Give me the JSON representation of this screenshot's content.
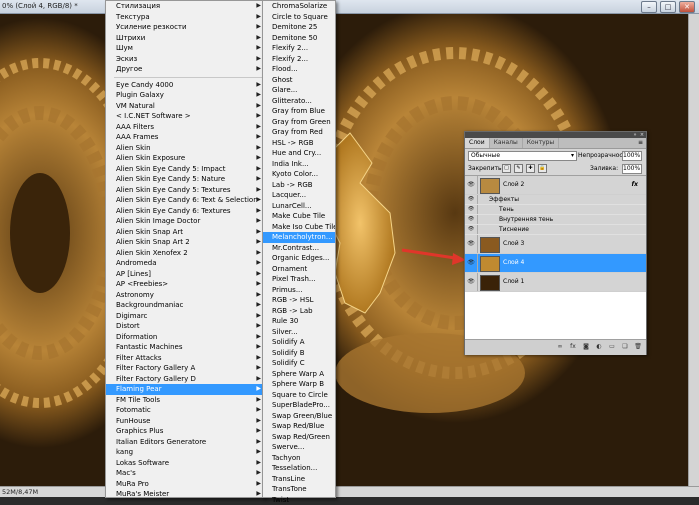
{
  "document": {
    "title": "0% (Слой 4, RGB/8) *",
    "status": "52M/8,47M",
    "window_buttons": [
      "–",
      "□",
      "✕"
    ]
  },
  "filter_menu": {
    "items": [
      {
        "label": "Стилизация",
        "submenu": true
      },
      {
        "label": "Текстура",
        "submenu": true
      },
      {
        "label": "Усиление резкости",
        "submenu": true
      },
      {
        "label": "Штрихи",
        "submenu": true
      },
      {
        "label": "Шум",
        "submenu": true
      },
      {
        "label": "Эскиз",
        "submenu": true
      },
      {
        "label": "Другое",
        "submenu": true
      },
      {
        "separator": true
      },
      {
        "label": "Eye Candy 4000",
        "submenu": true
      },
      {
        "label": "Plugin Galaxy",
        "submenu": true
      },
      {
        "label": "VM Natural",
        "submenu": true
      },
      {
        "label": "< I.C.NET Software >",
        "submenu": true
      },
      {
        "label": "AAA Filters",
        "submenu": true
      },
      {
        "label": "AAA Frames",
        "submenu": true
      },
      {
        "label": "Alien Skin",
        "submenu": true
      },
      {
        "label": "Alien Skin Exposure",
        "submenu": true
      },
      {
        "label": "Alien Skin Eye Candy 5: Impact",
        "submenu": true
      },
      {
        "label": "Alien Skin Eye Candy 5: Nature",
        "submenu": true
      },
      {
        "label": "Alien Skin Eye Candy 5: Textures",
        "submenu": true
      },
      {
        "label": "Alien Skin Eye Candy 6: Text & Selection",
        "submenu": true
      },
      {
        "label": "Alien Skin Eye Candy 6: Textures",
        "submenu": true
      },
      {
        "label": "Alien Skin Image Doctor",
        "submenu": true
      },
      {
        "label": "Alien Skin Snap Art",
        "submenu": true
      },
      {
        "label": "Alien Skin Snap Art 2",
        "submenu": true
      },
      {
        "label": "Alien Skin Xenofex 2",
        "submenu": true
      },
      {
        "label": "Andromeda",
        "submenu": true
      },
      {
        "label": "AP [Lines]",
        "submenu": true
      },
      {
        "label": "AP <Freebies>",
        "submenu": true
      },
      {
        "label": "Astronomy",
        "submenu": true
      },
      {
        "label": "Backgroundmaniac",
        "submenu": true
      },
      {
        "label": "Digimarc",
        "submenu": true
      },
      {
        "label": "Distort",
        "submenu": true
      },
      {
        "label": "Diformation",
        "submenu": true
      },
      {
        "label": "Fantastic Machines",
        "submenu": true
      },
      {
        "label": "Filter Attacks",
        "submenu": true
      },
      {
        "label": "Filter Factory Gallery A",
        "submenu": true
      },
      {
        "label": "Filter Factory Gallery D",
        "submenu": true
      },
      {
        "label": "Flaming Pear",
        "submenu": true,
        "selected": true
      },
      {
        "label": "FM Tile Tools",
        "submenu": true
      },
      {
        "label": "Fotomatic",
        "submenu": true
      },
      {
        "label": "FunHouse",
        "submenu": true
      },
      {
        "label": "Graphics Plus",
        "submenu": true
      },
      {
        "label": "Italian Editors Generatore",
        "submenu": true
      },
      {
        "label": "kang",
        "submenu": true
      },
      {
        "label": "Lokas Software",
        "submenu": true
      },
      {
        "label": "Mac's",
        "submenu": true
      },
      {
        "label": "MuRa Pro",
        "submenu": true
      },
      {
        "label": "MuRa's Meister",
        "submenu": true
      }
    ]
  },
  "flaming_pear_menu": {
    "items": [
      {
        "label": "ChromaSolarize"
      },
      {
        "label": "Circle to Square"
      },
      {
        "label": "Demitone 25"
      },
      {
        "label": "Demitone 50"
      },
      {
        "label": "Flexify 2..."
      },
      {
        "label": "Flexify 2..."
      },
      {
        "label": "Flood..."
      },
      {
        "label": "Ghost"
      },
      {
        "label": "Glare..."
      },
      {
        "label": "Glitterato..."
      },
      {
        "label": "Gray from Blue"
      },
      {
        "label": "Gray from Green"
      },
      {
        "label": "Gray from Red"
      },
      {
        "label": "HSL -> RGB"
      },
      {
        "label": "Hue and Cry..."
      },
      {
        "label": "India Ink..."
      },
      {
        "label": "Kyoto Color..."
      },
      {
        "label": "Lab -> RGB"
      },
      {
        "label": "Lacquer..."
      },
      {
        "label": "LunarCell..."
      },
      {
        "label": "Make Cube Tile"
      },
      {
        "label": "Make Iso Cube Tile"
      },
      {
        "label": "Melancholytron...",
        "selected": true
      },
      {
        "label": "Mr.Contrast..."
      },
      {
        "label": "Organic Edges..."
      },
      {
        "label": "Ornament"
      },
      {
        "label": "Pixel Trash..."
      },
      {
        "label": "Primus..."
      },
      {
        "label": "RGB -> HSL"
      },
      {
        "label": "RGB -> Lab"
      },
      {
        "label": "Rule 30"
      },
      {
        "label": "Silver..."
      },
      {
        "label": "Solidify A"
      },
      {
        "label": "Solidify B"
      },
      {
        "label": "Solidify C"
      },
      {
        "label": "Sphere Warp A"
      },
      {
        "label": "Sphere Warp B"
      },
      {
        "label": "Square to Circle"
      },
      {
        "label": "SuperBladePro..."
      },
      {
        "label": "Swap Green/Blue"
      },
      {
        "label": "Swap Red/Blue"
      },
      {
        "label": "Swap Red/Green"
      },
      {
        "label": "Swerve..."
      },
      {
        "label": "Tachyon"
      },
      {
        "label": "Tesselation..."
      },
      {
        "label": "TransLine"
      },
      {
        "label": "TransTone"
      },
      {
        "label": "Twist"
      }
    ]
  },
  "layers_panel": {
    "tabs": [
      "Слои",
      "Каналы",
      "Контуры"
    ],
    "active_tab": 0,
    "blend_mode": "Обычные",
    "opacity_label": "Непрозрачность:",
    "opacity_value": "100%",
    "lock_label": "Закрепить:",
    "fill_label": "Заливка:",
    "fill_value": "100%",
    "lock_icons": [
      "□",
      "✎",
      "✚",
      "🔒"
    ],
    "fx_badge": "fx",
    "effects_label": "Эффекты",
    "effects": [
      "Тень",
      "Внутренняя тень",
      "Тиснение"
    ],
    "layers": [
      {
        "name": "Слой 2",
        "thumb": "#b88a40"
      },
      {
        "name": "Слой 3",
        "thumb": "#8a5a20"
      },
      {
        "name": "Слой 4",
        "thumb": "#c08a30",
        "selected": true
      },
      {
        "name": "Слой 1",
        "thumb": "#3a2208"
      }
    ],
    "bottom_icons": [
      "∞",
      "fx",
      "◙",
      "◐",
      "▭",
      "❏",
      "🗑"
    ]
  },
  "colors": {
    "selection": "#3399ff",
    "canvas_dark": "#2c1c0a",
    "gold": "#c89a44",
    "arrow": "#e0362a"
  }
}
